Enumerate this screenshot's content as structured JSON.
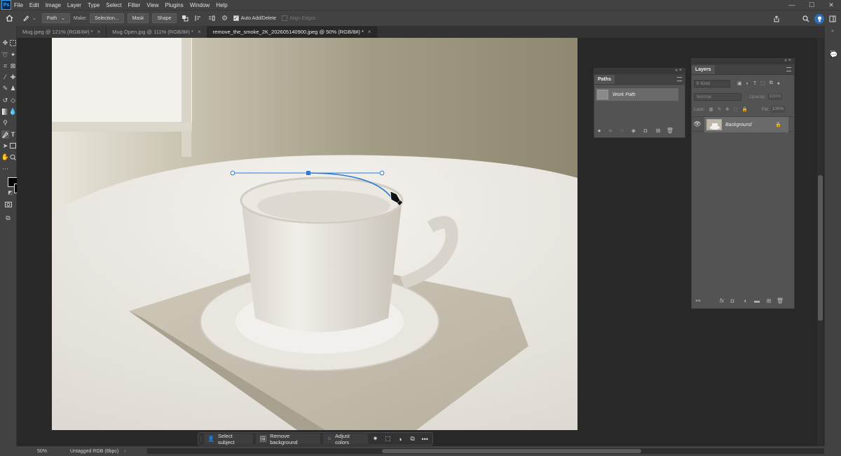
{
  "app": {
    "logo": "Ps"
  },
  "menu": [
    "File",
    "Edit",
    "Image",
    "Layer",
    "Type",
    "Select",
    "Filter",
    "View",
    "Plugins",
    "Window",
    "Help"
  ],
  "window_controls": {
    "minimize": "—",
    "maximize": "☐",
    "close": "✕"
  },
  "options": {
    "mode_select": "Path",
    "make_label": "Make:",
    "selection_button": "Selection...",
    "mask_button": "Mask",
    "shape_button": "Shape",
    "auto_add_delete": "Auto Add/Delete",
    "align_edges": "Align Edges"
  },
  "tabs": [
    {
      "label": "Mug.jpeg @ 121% (RGB/8#) *",
      "active": false
    },
    {
      "label": "Mug Open.jpg @ 111% (RGB/8#) *",
      "active": false
    },
    {
      "label": "remove_the_smoke_2K_202605140900.jpeg @ 50% (RGB/8#) *",
      "active": true
    }
  ],
  "tab_close": "×",
  "paths_panel": {
    "tab": "Paths",
    "items": [
      {
        "name": "Work Path"
      }
    ]
  },
  "layers_panel": {
    "tab": "Layers",
    "filter_placeholder": "Kind",
    "blend_mode": "Normal",
    "opacity_label": "Opacity:",
    "opacity_value": "100%",
    "lock_label": "Lock:",
    "fill_label": "Fill:",
    "fill_value": "100%",
    "layers": [
      {
        "name": "Background",
        "locked": true,
        "visible": true
      }
    ]
  },
  "context_bar": {
    "select_subject": "Select subject",
    "remove_background": "Remove background",
    "adjust_colors": "Adjust colors",
    "more": "•••"
  },
  "status": {
    "zoom": "50%",
    "profile": "Untagged RGB (8bpc)"
  },
  "colors": {
    "accent": "#31a8ff",
    "path_stroke": "#2b7bd0",
    "panel_bg": "#535353",
    "ui_bg": "#424242",
    "canvas_bg": "#282828"
  }
}
